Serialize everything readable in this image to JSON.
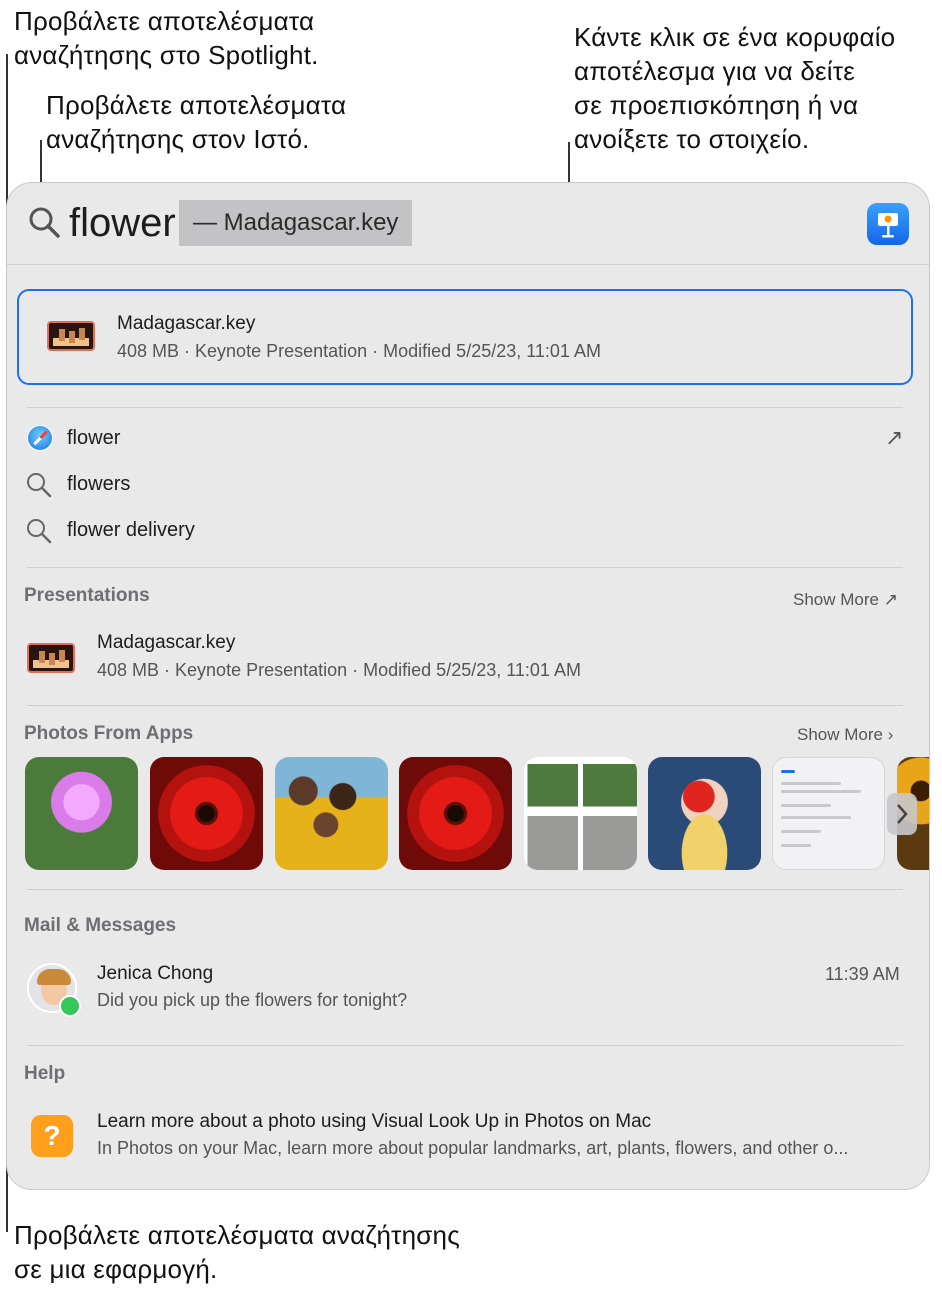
{
  "callouts": {
    "spotlight": "Προβάλετε αποτελέσματα\nαναζήτησης στο Spotlight.",
    "web": "Προβάλετε αποτελέσματα\nαναζήτησης στον Ιστό.",
    "top_hit": "Κάντε κλικ σε ένα κορυφαίο\nαποτέλεσμα για να δείτε\nσε προεπισκόπηση ή να\nανοίξετε το στοιχείο.",
    "app": "Προβάλετε αποτελέσματα αναζήτησης\nσε μια εφαρμογή."
  },
  "search": {
    "query": "flower",
    "suggestion": "— Madagascar.key",
    "icon": "magnifier-icon",
    "app_icon": "keynote-icon"
  },
  "top_hit": {
    "title": "Madagascar.key",
    "details": "408 MB · Keynote Presentation · Modified 5/25/23, 11:01 AM"
  },
  "web_results": [
    {
      "label": "flower",
      "icon": "safari-icon",
      "action": "↗"
    },
    {
      "label": "flowers",
      "icon": "magnifier-icon"
    },
    {
      "label": "flower delivery",
      "icon": "magnifier-icon"
    }
  ],
  "presentations": {
    "header": "Presentations",
    "show_more": "Show More ↗",
    "item": {
      "title": "Madagascar.key",
      "details": "408 MB · Keynote Presentation · Modified 5/25/23, 11:01 AM"
    }
  },
  "photos": {
    "header": "Photos From Apps",
    "show_more": "Show More ›"
  },
  "mail_messages": {
    "header": "Mail & Messages",
    "item": {
      "sender": "Jenica Chong",
      "time": "11:39 AM",
      "preview": "Did you pick up the flowers for tonight?"
    }
  },
  "help": {
    "header": "Help",
    "item": {
      "title": "Learn more about a photo using Visual Look Up in Photos on Mac",
      "preview": "In Photos on your Mac, learn more about popular landmarks, art, plants, flowers, and other o..."
    }
  },
  "colors": {
    "accent": "#1f6ff0",
    "panel": "#e9e9ea"
  }
}
